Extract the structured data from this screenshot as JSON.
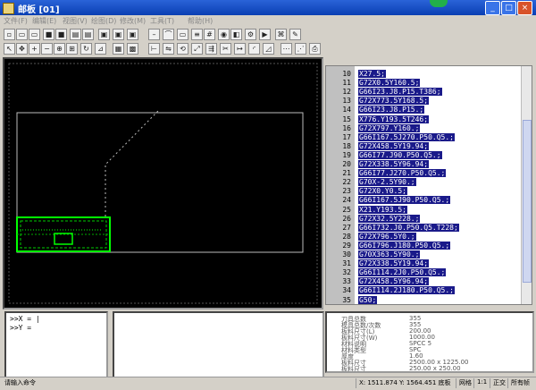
{
  "window": {
    "title": "邮板 [01]",
    "minimize": "_",
    "maximize": "□",
    "close": "×"
  },
  "menubar": [
    {
      "label": "文件(F)"
    },
    {
      "label": "编辑(E)"
    },
    {
      "label": "视图(V)"
    },
    {
      "label": "绘图(D)"
    },
    {
      "label": "修改(M)"
    },
    {
      "label": "工具(T)"
    },
    {
      "label": "帮助(H)"
    }
  ],
  "code": {
    "lines": [
      {
        "n": "10",
        "t": "X27.5;"
      },
      {
        "n": "11",
        "t": "G72X0.5Y160.5;"
      },
      {
        "n": "12",
        "t": "G66I23.J8.P15.T386;"
      },
      {
        "n": "13",
        "t": "G72X773.5Y168.5;"
      },
      {
        "n": "14",
        "t": "G66I23.J8.P15.;"
      },
      {
        "n": "15",
        "t": "X776.Y193.5T246;"
      },
      {
        "n": "16",
        "t": "G72X797.Y160.;"
      },
      {
        "n": "17",
        "t": "G66I167.5J270.P50.Q5.;"
      },
      {
        "n": "18",
        "t": "G72X458.5Y19.94;"
      },
      {
        "n": "19",
        "t": "G66I77.J90.P50.Q5.;"
      },
      {
        "n": "20",
        "t": "G72X338.5Y96.94;"
      },
      {
        "n": "21",
        "t": "G66I77.J270.P50.Q5.;"
      },
      {
        "n": "22",
        "t": "G70X-2.5Y90.;"
      },
      {
        "n": "23",
        "t": "G72X0.Y0.5;"
      },
      {
        "n": "24",
        "t": "G66I167.5J90.P50.Q5.;"
      },
      {
        "n": "25",
        "t": "X21.Y193.5;"
      },
      {
        "n": "26",
        "t": "G72X32.5Y228.;"
      },
      {
        "n": "27",
        "t": "G66I732.J0.P50.Q5.T228;"
      },
      {
        "n": "28",
        "t": "G72X796.5Y0.;"
      },
      {
        "n": "29",
        "t": "G66I796.J180.P50.Q5.;"
      },
      {
        "n": "30",
        "t": "G70X363.5Y90.;"
      },
      {
        "n": "31",
        "t": "G72X338.5Y19.94;"
      },
      {
        "n": "32",
        "t": "G66I114.2J0.P50.Q5.;"
      },
      {
        "n": "33",
        "t": "G72X458.5Y96.94;"
      },
      {
        "n": "34",
        "t": "G66I114.2J180.P50.Q5.;"
      },
      {
        "n": "35",
        "t": "G50;"
      }
    ]
  },
  "command": {
    "line1": ">>X = |",
    "line2": ">>Y ="
  },
  "properties": [
    {
      "k": "刀具总数",
      "v": "355"
    },
    {
      "k": "模具总数/次数",
      "v": "355"
    },
    {
      "k": "板料尺寸(L)",
      "v": "200.00"
    },
    {
      "k": "板料尺寸(W)",
      "v": "1000.00"
    },
    {
      "k": "材料说明",
      "v": "SPCC 5"
    },
    {
      "k": "材料类型",
      "v": "SPC"
    },
    {
      "k": "厚度",
      "v": "1.60"
    },
    {
      "k": "板料尺寸",
      "v": "2500.00 x 1225.00"
    },
    {
      "k": "板料尺寸",
      "v": "250.00 x 250.00"
    }
  ],
  "status": {
    "prompt": "请输入命令",
    "coords": "X: 1511.874 Y: 1564.451 底板",
    "snap": "网格",
    "scale": "1:1",
    "angle": "正交",
    "extra": "所有帧"
  },
  "colors": {
    "cad_bg": "#000000",
    "part_outline": "#00ff00",
    "sheet": "#c8c8c8"
  }
}
